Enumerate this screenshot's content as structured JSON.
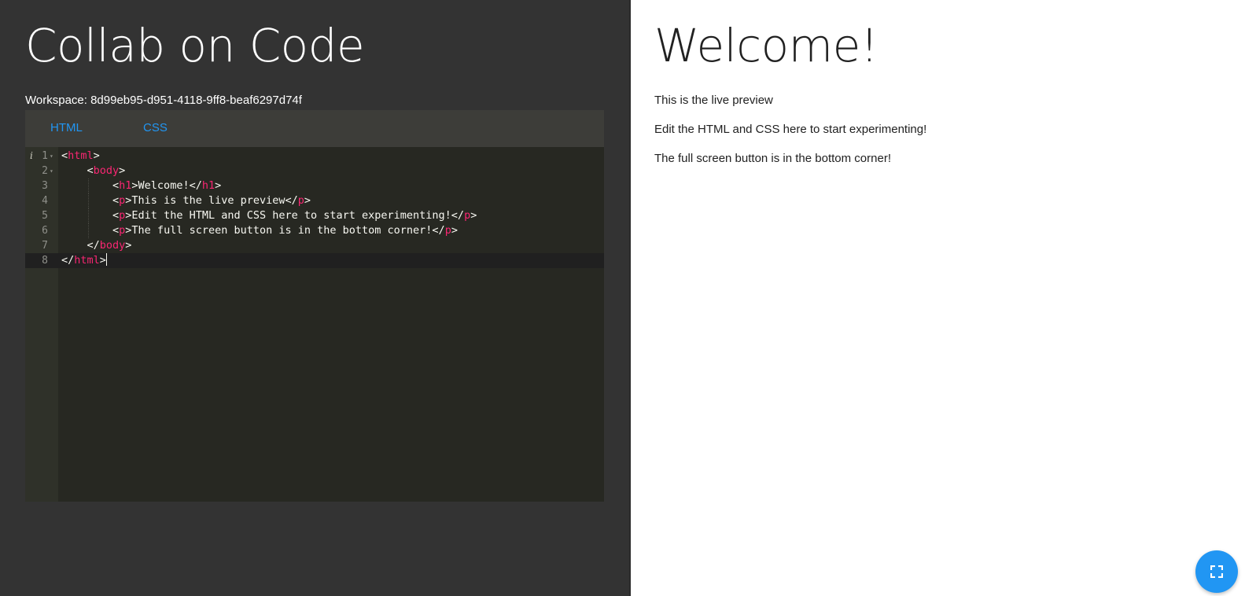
{
  "header": {
    "title": "Collab on Code",
    "workspace_label": "Workspace: 8d99eb95-d951-4118-9ff8-beaf6297d74f"
  },
  "editor": {
    "tabs": [
      {
        "label": "HTML",
        "active": true
      },
      {
        "label": "CSS",
        "active": false
      }
    ],
    "info_marker": "i",
    "lines": [
      {
        "number": "1",
        "text": "<html>"
      },
      {
        "number": "2",
        "text": "    <body>"
      },
      {
        "number": "3",
        "text": "        <h1>Welcome!</h1>"
      },
      {
        "number": "4",
        "text": "        <p>This is the live preview</p>"
      },
      {
        "number": "5",
        "text": "        <p>Edit the HTML and CSS here to start experimenting!</p>"
      },
      {
        "number": "6",
        "text": "        <p>The full screen button is in the bottom corner!</p>"
      },
      {
        "number": "7",
        "text": "    </body>"
      },
      {
        "number": "8",
        "text": "</html>"
      }
    ],
    "active_line": "8"
  },
  "preview": {
    "heading": "Welcome!",
    "paragraphs": [
      "This is the live preview",
      "Edit the HTML and CSS here to start experimenting!",
      "The full screen button is in the bottom corner!"
    ]
  },
  "fullscreen_button": {
    "icon": "fullscreen-icon"
  },
  "colors": {
    "accent": "#2196f3",
    "left_panel_bg": "#333333",
    "editor_bg": "#272822",
    "tag_color": "#f92672"
  }
}
